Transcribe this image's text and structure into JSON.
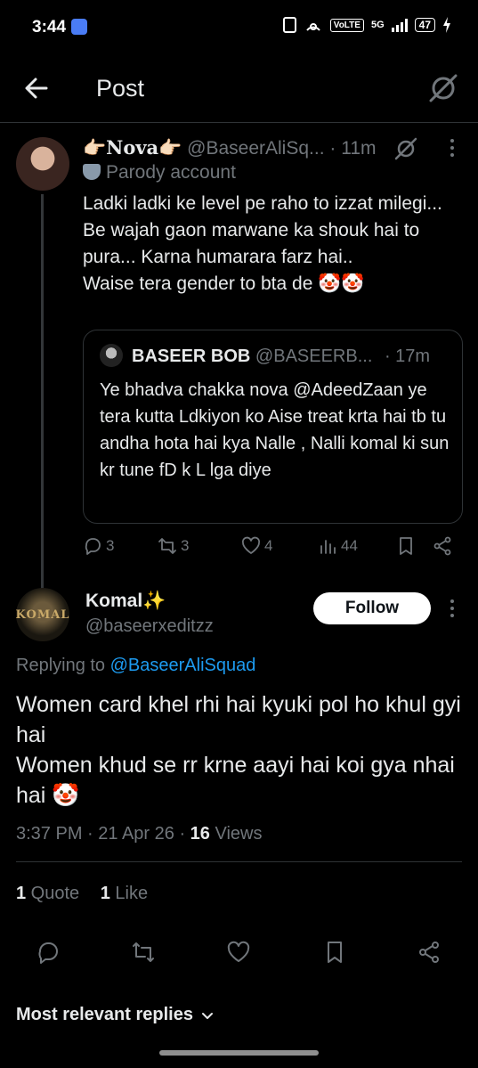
{
  "status_bar": {
    "time": "3:44",
    "network": "5G",
    "volte": "VoLTE",
    "battery": "47"
  },
  "header": {
    "title": "Post"
  },
  "post": {
    "author_name": "👉🏻Nova👉🏻",
    "author_handle": "@BaseerAliSq...",
    "time": "· 11m",
    "badge": "Parody account",
    "text": "Ladki ladki ke level pe raho to izzat milegi...\nBe wajah gaon marwane ka shouk hai to pura... Karna humarara farz hai..\nWaise tera gender to bta de 🤡🤡",
    "quote": {
      "author_name": "BASEER BOB",
      "author_handle": "@BASEERB...",
      "time": "· 17m",
      "text": "Ye bhadva chakka nova  @AdeedZaan ye tera kutta Ldkiyon ko Aise treat krta hai tb tu andha hota hai kya Nalle , Nalli komal ki sun kr tune fD k L lga diye"
    },
    "actions": {
      "replies": "3",
      "reposts": "3",
      "likes": "4",
      "views": "44"
    }
  },
  "reply": {
    "author_name": "Komal✨",
    "author_handle": "@baseerxeditzz",
    "avatar_text": "KOMAL",
    "follow_label": "Follow",
    "replying_prefix": "Replying to ",
    "replying_to": "@BaseerAliSquad",
    "text": "Women card khel rhi hai kyuki pol ho khul gyi hai\nWomen khud se rr krne aayi hai koi gya nhai hai 🤡",
    "timestamp": "3:37 PM · 21 Apr 26 · ",
    "views_count": "16",
    "views_label": " Views",
    "quotes_count": "1",
    "quotes_label": " Quote",
    "likes_count": "1",
    "likes_label": " Like"
  },
  "footer": {
    "sort_label": "Most relevant replies"
  },
  "colors": {
    "background": "#000000",
    "text": "#e7e9ea",
    "muted": "#71767b",
    "link": "#1d9bf0",
    "border": "#2f3336"
  }
}
